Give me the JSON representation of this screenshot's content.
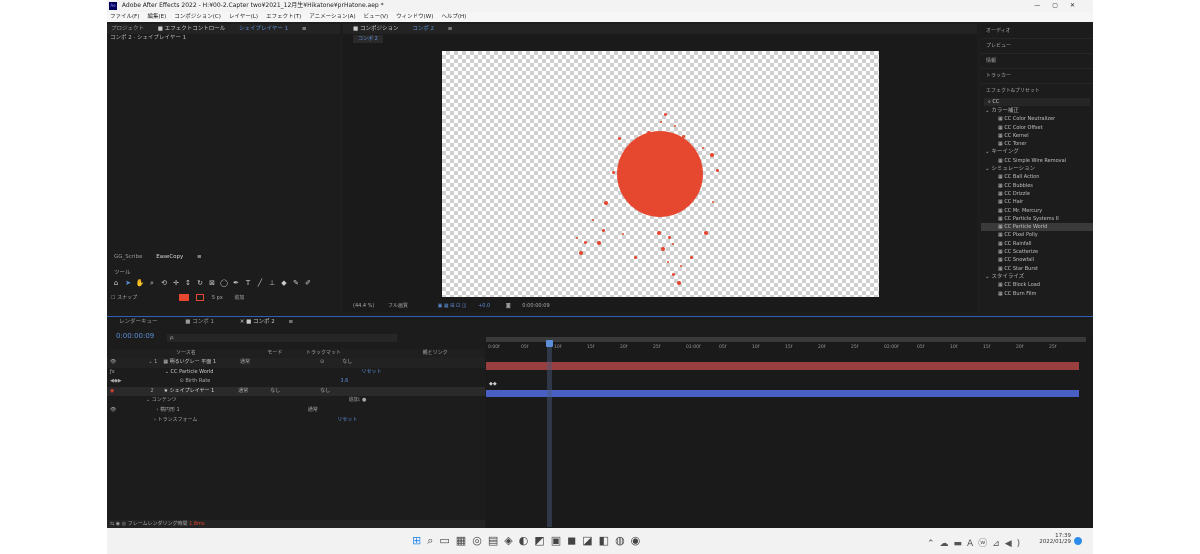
{
  "titlebar": {
    "title": "Adobe After Effects 2022 - H:¥00-2.Capter two¥2021_12月生¥Hikatone¥prHatone.aep *",
    "controls": [
      "—",
      "▢",
      "✕"
    ]
  },
  "menu": [
    "ファイル(F)",
    "編集(E)",
    "コンポジション(C)",
    "レイヤー(L)",
    "エフェクト(T)",
    "アニメーション(A)",
    "ビュー(V)",
    "ウィンドウ(W)",
    "ヘルプ(H)"
  ],
  "project": {
    "tab_project": "プロジェクト",
    "tab_effects": "エフェクトコントロール",
    "tab_effects_target": "シェイプレイヤー 1",
    "header": "コンポ 2 · シェイプレイヤー 1"
  },
  "composition": {
    "tab": "コンポジション",
    "tab_name": "コンポ 2",
    "chip": "コンポ 2",
    "zoom": "(44.4 %)",
    "quality": "フル画質",
    "timecode": "0:00:00:09",
    "exposure": "+0.0"
  },
  "ext": {
    "tab1": "GG_Scribe",
    "tab2": "EaseCopy"
  },
  "tools": {
    "title": "ツール",
    "snap": "スナップ",
    "stroke_px": "5 px",
    "add": "追加"
  },
  "right": {
    "items": [
      "オーディオ",
      "プレビュー",
      "情報",
      "トラッカー"
    ],
    "presets_title": "エフェクト&プリセット",
    "search": "CC",
    "groups": [
      {
        "name": "カラー補正",
        "items": [
          "CC Color Neutralizer",
          "CC Color Offset",
          "CC Kernel",
          "CC Toner"
        ]
      },
      {
        "name": "キーイング",
        "items": [
          "CC Simple Wire Removal"
        ]
      },
      {
        "name": "シミュレーション",
        "items": [
          "CC Ball Action",
          "CC Bubbles",
          "CC Drizzle",
          "CC Hair",
          "CC Mr. Mercury",
          "CC Particle Systems II",
          "CC Particle World",
          "CC Pixel Polly",
          "CC Rainfall",
          "CC Scatterize",
          "CC Snowfall",
          "CC Star Burst"
        ]
      },
      {
        "name": "スタイライズ",
        "items": [
          "CC Block Load",
          "CC Burn Film"
        ]
      }
    ],
    "selected": "CC Particle World"
  },
  "timeline": {
    "tab_render": "レンダーキュー",
    "tab_comp1": "コンポ 1",
    "tab_comp2": "コンポ 2",
    "timecode": "0:00:00:09",
    "search": "ρ.",
    "headers": {
      "source": "ソース名",
      "mode": "モード",
      "trkmat": "トラックマット",
      "parent": "親とリンク"
    },
    "layers": [
      {
        "num": "1",
        "name": "明るいグレー 平面 1",
        "mode": "通常",
        "parent": "なし"
      },
      {
        "effect": "CC Particle World",
        "reset": "リセット"
      },
      {
        "prop": "Birth Rate",
        "value": "3.6"
      },
      {
        "num": "2",
        "name": "シェイプレイヤー 1",
        "mode": "通常",
        "trk": "なし",
        "parent": "なし"
      },
      {
        "prop": "コンテンツ",
        "add": "追加: ●"
      },
      {
        "prop": "楕円形 1",
        "mode": "通常"
      },
      {
        "prop": "トランスフォーム",
        "reset": "リセット"
      }
    ],
    "ruler": [
      "0:00f",
      "05f",
      "10f",
      "15f",
      "20f",
      "25f",
      "01:00f",
      "05f",
      "10f",
      "15f",
      "20f",
      "25f",
      "02:00f",
      "05f",
      "10f",
      "15f",
      "20f",
      "25f"
    ],
    "footer": "フレームレンダリング時間",
    "footer_val": "1.8ms"
  },
  "taskbar": {
    "time": "17:39",
    "date": "2022/01/29"
  },
  "colors": {
    "accent": "#2d8ceb",
    "circle": "#e6482f",
    "layer1": "#9a3f3f",
    "layer2": "#4a5fc4"
  }
}
